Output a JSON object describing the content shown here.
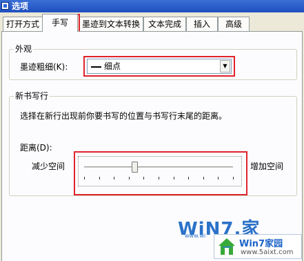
{
  "window": {
    "title": "选项"
  },
  "tabs": [
    {
      "label": "打开方式"
    },
    {
      "label": "手写"
    },
    {
      "label": "墨迹到文本转换"
    },
    {
      "label": "文本完成"
    },
    {
      "label": "插入"
    },
    {
      "label": "高级"
    }
  ],
  "active_tab": "手写",
  "appearance": {
    "group_title": "外观",
    "ink_thickness_label": "墨迹粗细(K):",
    "ink_thickness_value": "细点",
    "ink_thickness_icon": "thin-line-icon"
  },
  "new_line": {
    "group_title": "新书写行",
    "description": "选择在新行出现前你要书写的位置与书写行末尾的距离。",
    "distance_label": "距离(D):",
    "less_space_label": "减少空间",
    "more_space_label": "增加空间",
    "slider_value_fraction": 0.34,
    "slider_tick_count": 11
  },
  "watermark": {
    "brand": "WiN7.家",
    "url_partial": "www.wi",
    "logo_text": "Win7家园",
    "logo_url": "www.5aixt.com"
  },
  "colors": {
    "highlight_red": "#e0232b",
    "titlebar_blue": "#2454c8",
    "dialog_background": "#ece9d8"
  }
}
